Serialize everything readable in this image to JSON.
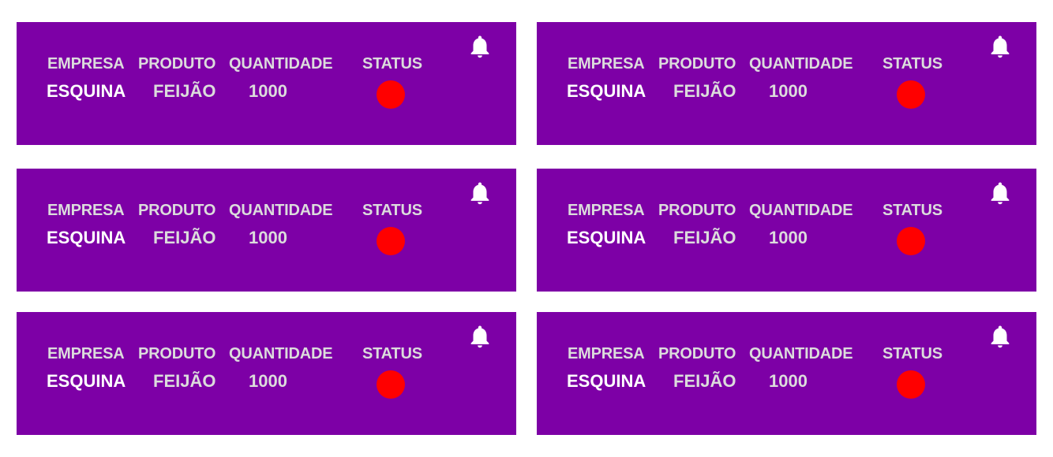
{
  "colors": {
    "card_background": "#7d00a6",
    "status_dot": "#ff0000",
    "header_text": "#dcdcdc",
    "value_text": "#ffffff"
  },
  "cards": [
    {
      "headers": {
        "empresa": "EMPRESA",
        "produto": "PRODUTO",
        "quantidade": "QUANTIDADE",
        "status": "STATUS"
      },
      "values": {
        "empresa": "ESQUINA",
        "produto": "FEIJÃO",
        "quantidade": "1000"
      },
      "status_icon": "red-circle-icon",
      "notify_icon": "bell-icon"
    },
    {
      "headers": {
        "empresa": "EMPRESA",
        "produto": "PRODUTO",
        "quantidade": "QUANTIDADE",
        "status": "STATUS"
      },
      "values": {
        "empresa": "ESQUINA",
        "produto": "FEIJÃO",
        "quantidade": "1000"
      },
      "status_icon": "red-circle-icon",
      "notify_icon": "bell-icon"
    },
    {
      "headers": {
        "empresa": "EMPRESA",
        "produto": "PRODUTO",
        "quantidade": "QUANTIDADE",
        "status": "STATUS"
      },
      "values": {
        "empresa": "ESQUINA",
        "produto": "FEIJÃO",
        "quantidade": "1000"
      },
      "status_icon": "red-circle-icon",
      "notify_icon": "bell-icon"
    },
    {
      "headers": {
        "empresa": "EMPRESA",
        "produto": "PRODUTO",
        "quantidade": "QUANTIDADE",
        "status": "STATUS"
      },
      "values": {
        "empresa": "ESQUINA",
        "produto": "FEIJÃO",
        "quantidade": "1000"
      },
      "status_icon": "red-circle-icon",
      "notify_icon": "bell-icon"
    },
    {
      "headers": {
        "empresa": "EMPRESA",
        "produto": "PRODUTO",
        "quantidade": "QUANTIDADE",
        "status": "STATUS"
      },
      "values": {
        "empresa": "ESQUINA",
        "produto": "FEIJÃO",
        "quantidade": "1000"
      },
      "status_icon": "red-circle-icon",
      "notify_icon": "bell-icon"
    },
    {
      "headers": {
        "empresa": "EMPRESA",
        "produto": "PRODUTO",
        "quantidade": "QUANTIDADE",
        "status": "STATUS"
      },
      "values": {
        "empresa": "ESQUINA",
        "produto": "FEIJÃO",
        "quantidade": "1000"
      },
      "status_icon": "red-circle-icon",
      "notify_icon": "bell-icon"
    }
  ]
}
